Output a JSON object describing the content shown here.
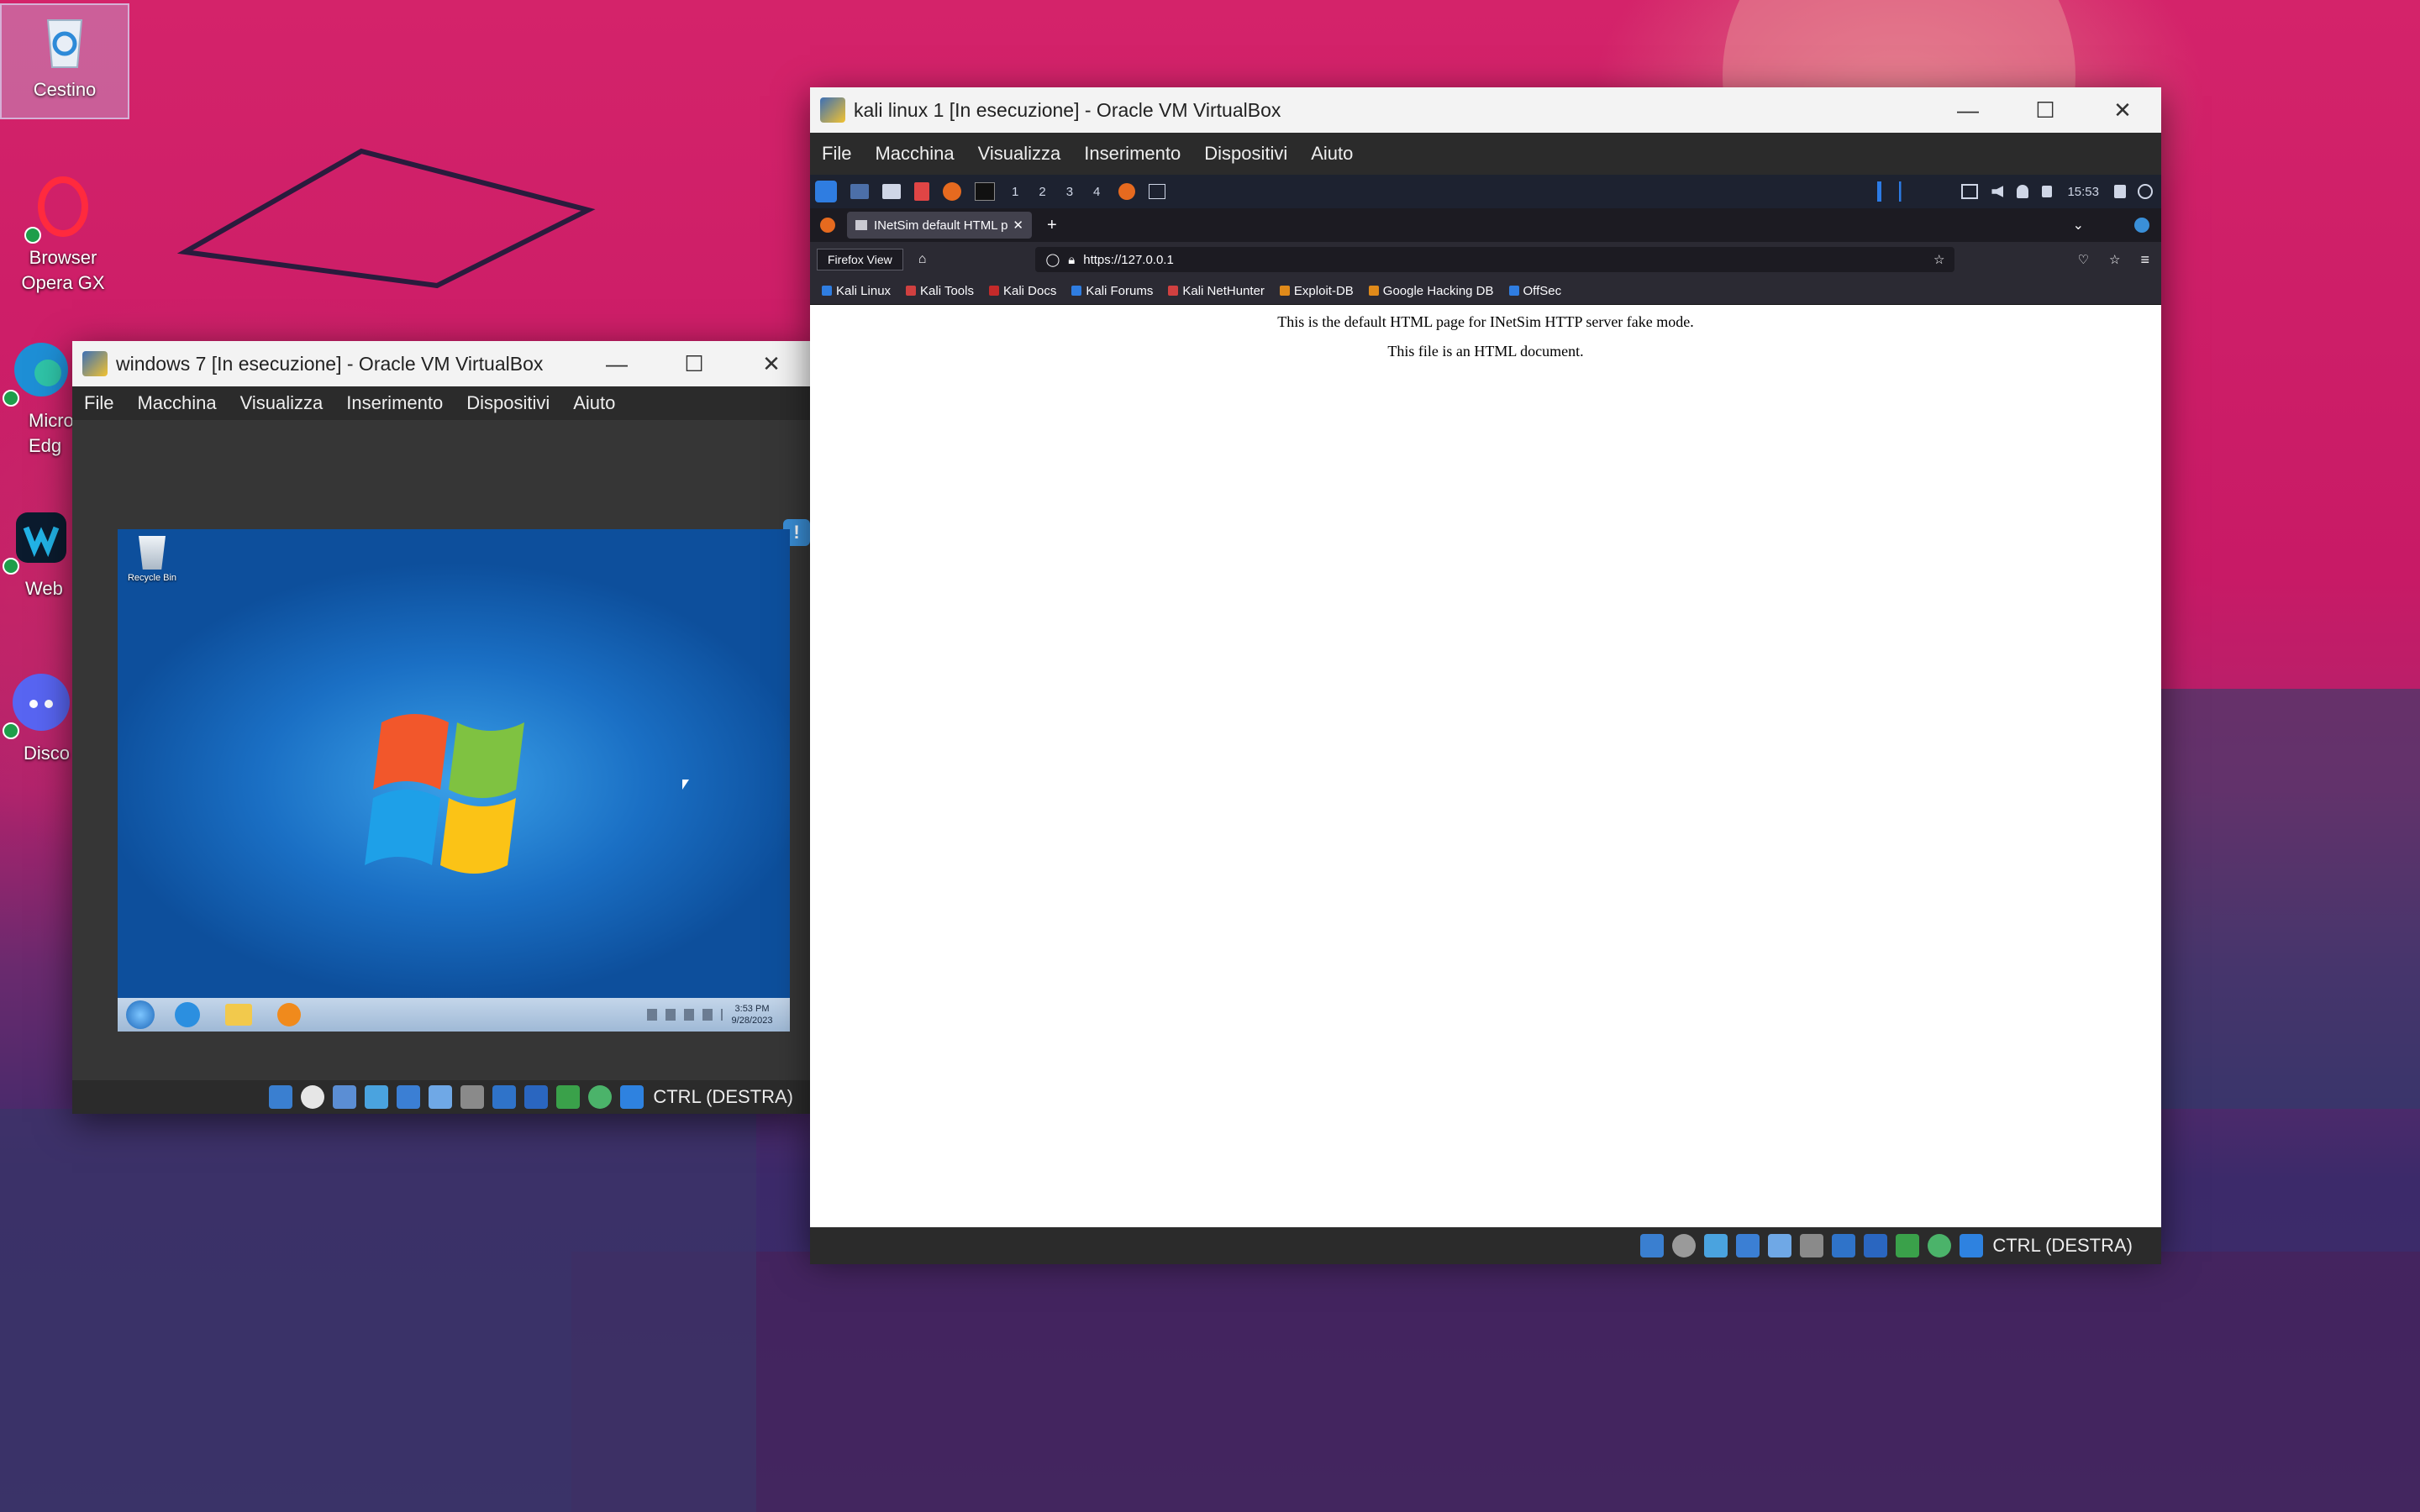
{
  "desktop": {
    "icons": [
      {
        "label": "Cestino"
      },
      {
        "label": "Browser Opera GX"
      },
      {
        "label": "Micro Edg"
      },
      {
        "label": "Web"
      },
      {
        "label": "Disco"
      }
    ]
  },
  "win7_window": {
    "title": "windows 7 [In esecuzione] - Oracle VM VirtualBox",
    "menu": [
      "File",
      "Macchina",
      "Visualizza",
      "Inserimento",
      "Dispositivi",
      "Aiuto"
    ],
    "status_key": "CTRL (DESTRA)",
    "guest": {
      "recycle_bin": "Recycle Bin",
      "clock_time": "3:53 PM",
      "clock_date": "9/28/2023"
    }
  },
  "kali_window": {
    "title": "kali linux 1 [In esecuzione] - Oracle VM VirtualBox",
    "menu": [
      "File",
      "Macchina",
      "Visualizza",
      "Inserimento",
      "Dispositivi",
      "Aiuto"
    ],
    "status_key": "CTRL (DESTRA)",
    "panel": {
      "workspaces": [
        "1",
        "2",
        "3",
        "4"
      ],
      "clock": "15:53"
    },
    "browser": {
      "tab_title": "INetSim default HTML pa",
      "firefox_view_tooltip": "Firefox View",
      "url": "https://127.0.0.1",
      "bookmarks": [
        "Kali Linux",
        "Kali Tools",
        "Kali Docs",
        "Kali Forums",
        "Kali NetHunter",
        "Exploit-DB",
        "Google Hacking DB",
        "OffSec"
      ],
      "page_lines": [
        "This is the default HTML page for INetSim HTTP server fake mode.",
        "This file is an HTML document."
      ]
    }
  },
  "colors": {
    "wallpaper_pink": "#c81a66",
    "wallpaper_purple": "#3a2f6a",
    "vbox_dark": "#2b2b2b",
    "firefox_toolbar": "#2b2a33",
    "win7_blue": "#1a6fc4"
  }
}
